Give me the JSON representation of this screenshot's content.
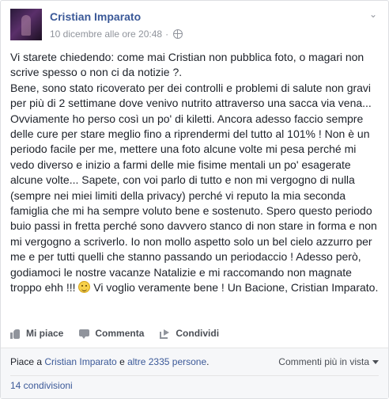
{
  "post": {
    "author": "Cristian Imparato",
    "timestamp": "10 dicembre alle ore 20:48",
    "separator": "·",
    "text_before_emoji": "Vi starete chiedendo: come mai Cristian non pubblica foto, o magari non scrive spesso o non ci da notizie ?.\nBene, sono stato ricoverato per dei controlli e problemi di salute non gravi per più di 2 settimane dove venivo nutrito attraverso una sacca via vena... Ovviamente ho perso così un po' di kiletti. Ancora adesso faccio sempre delle cure per stare meglio fino a riprendermi del tutto al 101% ! Non è un periodo facile per me, mettere una foto alcune volte mi pesa perché mi vedo diverso e inizio a farmi delle mie fisime mentali un po' esagerate alcune volte... Sapete, con voi parlo di tutto e non mi vergogno di nulla (sempre nei miei limiti della privacy) perché vi reputo la mia seconda famiglia che mi ha sempre voluto bene e sostenuto. Spero questo periodo buio passi in fretta perché sono davvero stanco di non stare in forma e non mi vergogno a scriverlo. Io non mollo aspetto solo un bel cielo azzurro per me e per tutti quelli che stanno passando un periodaccio ! Adesso però, godiamoci le nostre vacanze Natalizie e mi raccomando non magnate troppo ehh !!! ",
    "text_after_emoji": " Vi voglio veramente bene ! Un Bacione, Cristian Imparato."
  },
  "icons": {
    "privacy": "globe-icon",
    "options": "chevron-down-icon",
    "emoji": "smile-emoji-icon",
    "like": "thumbs-up-icon",
    "comment": "comment-icon",
    "share": "share-icon"
  },
  "actions": {
    "like_label": "Mi piace",
    "comment_label": "Commenta",
    "share_label": "Condividi"
  },
  "footer": {
    "likes_prefix": "Piace a ",
    "likes_user": "Cristian Imparato",
    "likes_middle": " e ",
    "likes_others": "altre 2335 persone",
    "likes_suffix": ".",
    "comments_view": "Commenti più in vista",
    "shares": "14 condivisioni"
  },
  "colors": {
    "link": "#3b5998",
    "meta": "#90949c",
    "footer_bg": "#f6f7f9"
  }
}
